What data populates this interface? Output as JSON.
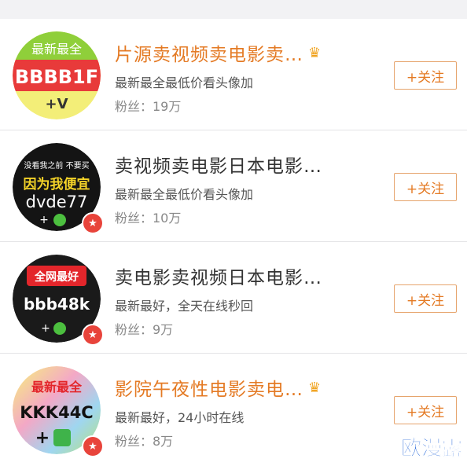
{
  "rows": [
    {
      "name": "片源卖视频卖电影卖…",
      "name_color": "orange",
      "desc": "最新最全最低价看头像加",
      "fans": "粉丝：19万",
      "follow_label": "+关注",
      "avatar": {
        "top": "最新最全",
        "mid": "BBBB1F",
        "bottom": "+V"
      }
    },
    {
      "name": "卖视频卖电影日本电影…",
      "name_color": "dark",
      "desc": "最新最全最低价看头像加",
      "fans": "粉丝：10万",
      "follow_label": "+关注",
      "avatar": {
        "top": "没看我之前 不要买",
        "mid1": "因为我便宜",
        "mid": "dvde77",
        "bottom": "+"
      }
    },
    {
      "name": "卖电影卖视频日本电影…",
      "name_color": "dark",
      "desc": "最新最好，全天在线秒回",
      "fans": "粉丝：9万",
      "follow_label": "+关注",
      "avatar": {
        "top": "全网最好",
        "mid": "bbb48k",
        "bottom": "+"
      }
    },
    {
      "name": "影院午夜性电影卖电…",
      "name_color": "orange",
      "desc": "最新最好，24小时在线",
      "fans": "粉丝：8万",
      "follow_label": "+关注",
      "avatar": {
        "top": "最新最全",
        "mid": "KKK44C",
        "bottom": "+"
      }
    }
  ],
  "watermark": "欧漫露",
  "colors": {
    "accent": "#e47a24",
    "badge": "#e8443b"
  },
  "icons": {
    "crown": "crown-icon",
    "badge": "star-badge-icon",
    "wechat": "wechat-icon"
  }
}
